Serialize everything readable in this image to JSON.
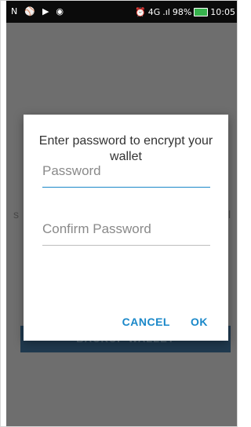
{
  "statusbar": {
    "icons_left": [
      "N",
      "⚾",
      "▶",
      "◉"
    ],
    "alarm": "⏰",
    "network": "4G",
    "signal": ".ıl",
    "battery_percent": "98%",
    "time": "10:05"
  },
  "background": {
    "left_fragment": "s",
    "right_fragment": "l",
    "button_label": "BACKUP WALLET"
  },
  "dialog": {
    "title": "Enter password to encrypt your wallet",
    "password": {
      "placeholder": "Password",
      "value": ""
    },
    "confirm": {
      "placeholder": "Confirm Password",
      "value": ""
    },
    "cancel_label": "CANCEL",
    "ok_label": "OK"
  },
  "colors": {
    "accent": "#1a88c9",
    "overlay": "#6e6e6e",
    "statusbar": "#0b0b0b",
    "battery": "#37b24d"
  }
}
